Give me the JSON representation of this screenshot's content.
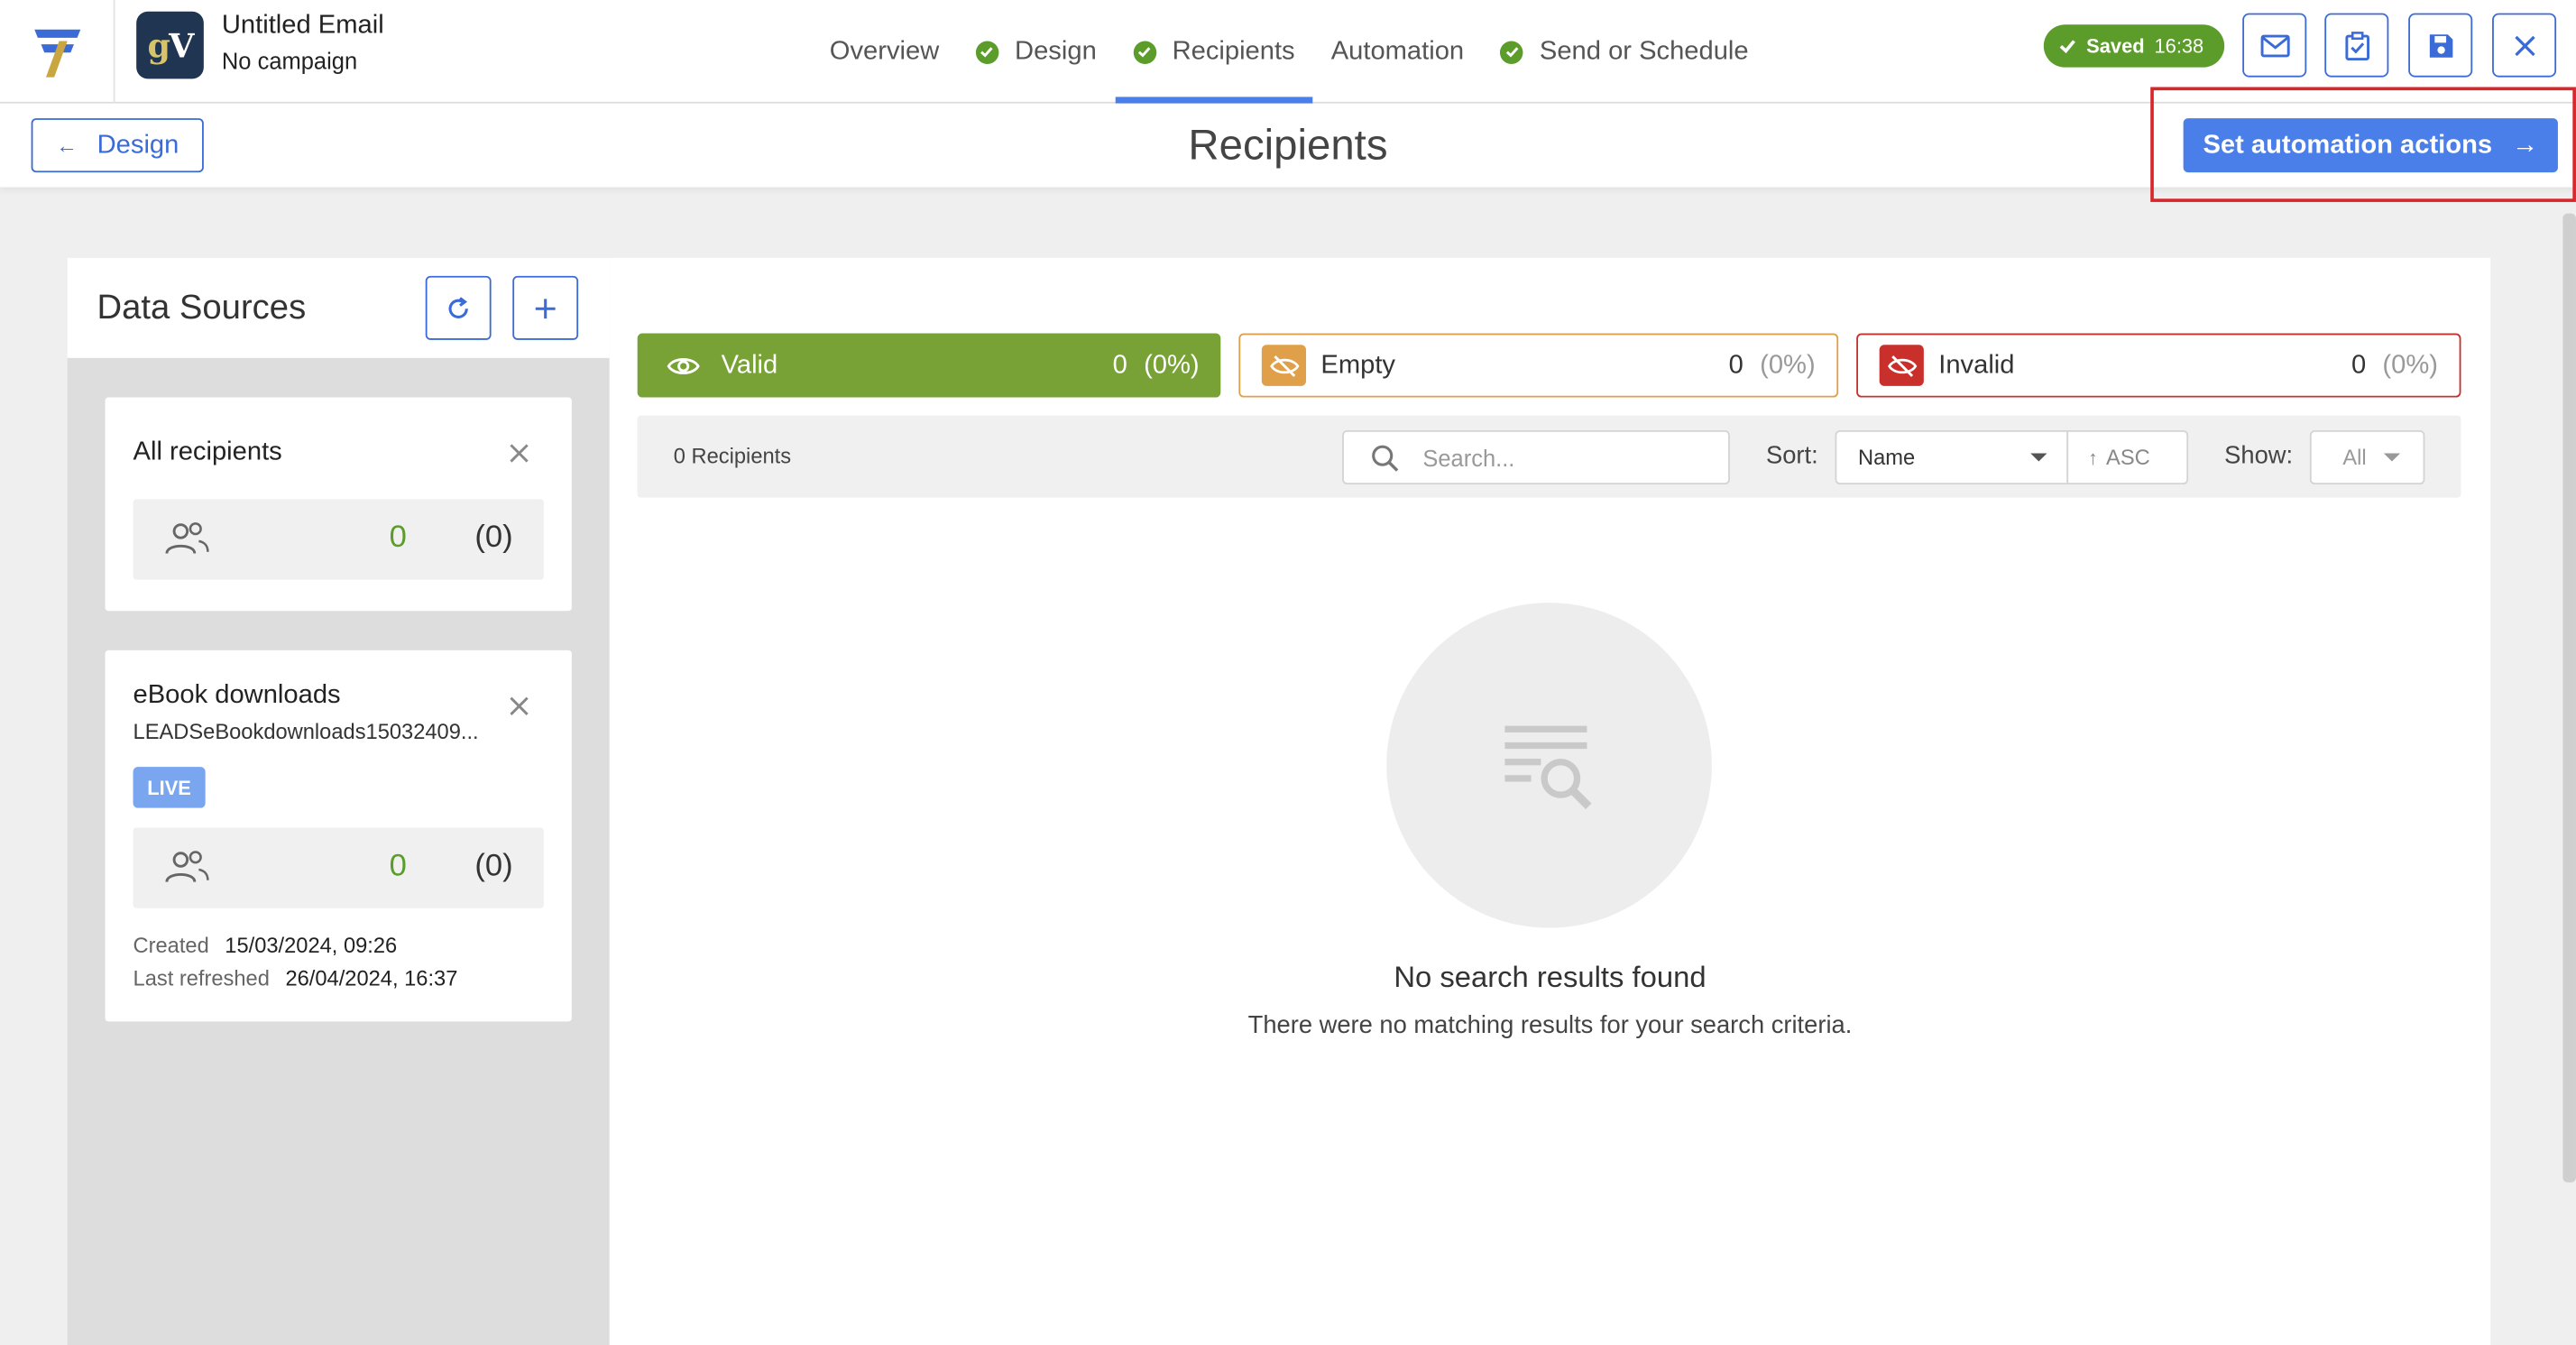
{
  "header": {
    "brand_text": "gV",
    "email_title": "Untitled Email",
    "campaign": "No campaign",
    "tabs": [
      {
        "label": "Overview",
        "done": false,
        "active": false
      },
      {
        "label": "Design",
        "done": true,
        "active": false
      },
      {
        "label": "Recipients",
        "done": true,
        "active": true
      },
      {
        "label": "Automation",
        "done": false,
        "active": false
      },
      {
        "label": "Send or Schedule",
        "done": true,
        "active": false
      }
    ],
    "saved_label": "Saved",
    "saved_time": "16:38",
    "buttons": [
      "email-preview-icon",
      "checklist-icon",
      "save-icon",
      "close-icon"
    ]
  },
  "subheader": {
    "back_label": "Design",
    "title": "Recipients",
    "primary_label": "Set automation actions"
  },
  "sources": {
    "title": "Data Sources",
    "cards": [
      {
        "title": "All recipients",
        "count": "0",
        "pct": "(0)"
      },
      {
        "title": "eBook downloads",
        "subtitle": "LEADSeBookdownloads15032409...",
        "badge": "LIVE",
        "count": "0",
        "pct": "(0)",
        "created_label": "Created",
        "created_value": "15/03/2024, 09:26",
        "refreshed_label": "Last refreshed",
        "refreshed_value": "26/04/2024, 16:37"
      }
    ]
  },
  "stats": {
    "valid": {
      "label": "Valid",
      "count": "0",
      "pct": "(0%)"
    },
    "empty": {
      "label": "Empty",
      "count": "0",
      "pct": "(0%)"
    },
    "invalid": {
      "label": "Invalid",
      "count": "0",
      "pct": "(0%)"
    }
  },
  "toolbar": {
    "count_text": "0 Recipients",
    "search_placeholder": "Search...",
    "sort_label": "Sort:",
    "sort_value": "Name",
    "order_value": "ASC",
    "show_label": "Show:",
    "show_value": "All"
  },
  "empty_state": {
    "title": "No search results found",
    "subtitle": "There were no matching results for your search criteria."
  },
  "colors": {
    "accent": "#4a7ee9",
    "success": "#5b9c2b",
    "valid_bg": "#78a235",
    "empty_border": "#e0a04a",
    "invalid_border": "#c9302c",
    "highlight": "#d9262b"
  }
}
